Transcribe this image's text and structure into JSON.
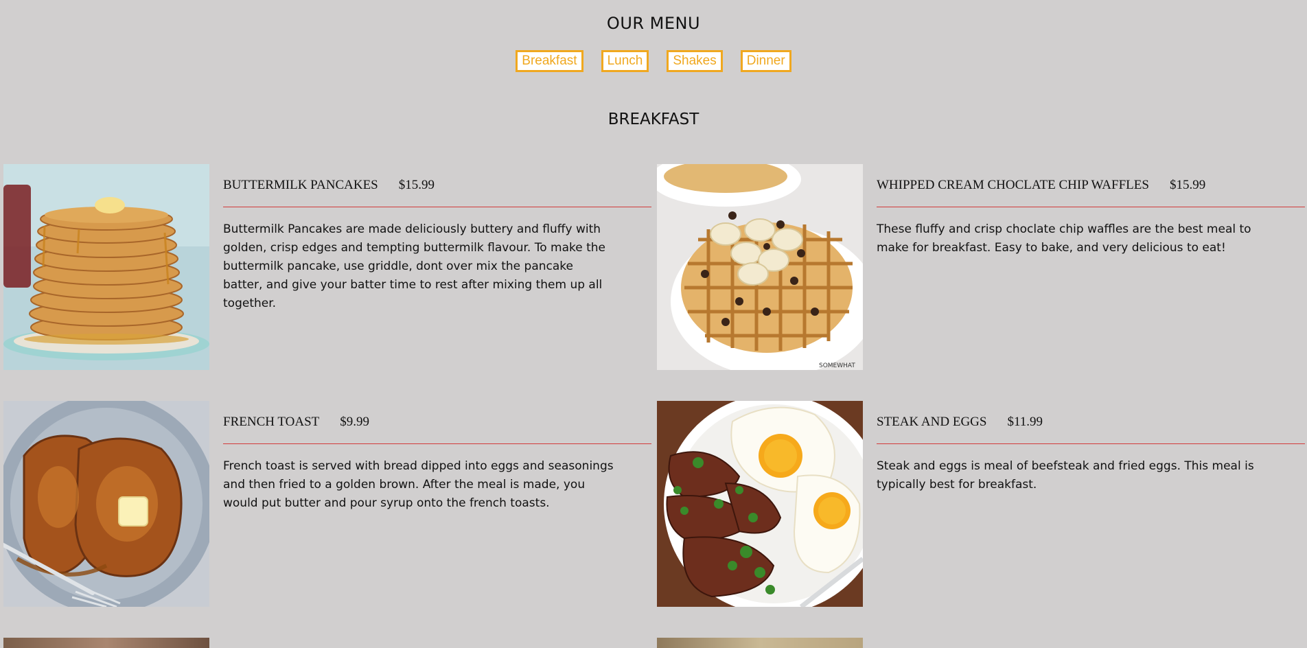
{
  "header": {
    "title": "OUR MENU"
  },
  "tabs": [
    {
      "label": "Breakfast"
    },
    {
      "label": "Lunch"
    },
    {
      "label": "Shakes"
    },
    {
      "label": "Dinner"
    }
  ],
  "section": {
    "title": "BREAKFAST"
  },
  "items": [
    {
      "name": "BUTTERMILK PANCAKES",
      "price": "$15.99",
      "description": "Buttermilk Pancakes are made deliciously buttery and fluffy with golden, crisp edges and tempting buttermilk flavour. To make the buttermilk pancake, use griddle, dont over mix the pancake batter, and give your batter time to rest after mixing them up all together."
    },
    {
      "name": "WHIPPED CREAM CHOCLATE CHIP WAFFLES",
      "price": "$15.99",
      "description": "These fluffy and crisp choclate chip waffles are the best meal to make for breakfast. Easy to bake, and very delicious to eat!",
      "photo_watermark": "SOMEWHAT"
    },
    {
      "name": "FRENCH TOAST",
      "price": "$9.99",
      "description": "French toast is served with bread dipped into eggs and seasonings and then fried to a golden brown. After the meal is made, you would put butter and pour syrup onto the french toasts."
    },
    {
      "name": "STEAK AND EGGS",
      "price": "$11.99",
      "description": "Steak and eggs is meal of beefsteak and fried eggs. This meal is typically best for breakfast."
    }
  ],
  "colors": {
    "background": "#d1cfcf",
    "tab_accent": "#f0a81f",
    "divider": "#d23a3a"
  }
}
